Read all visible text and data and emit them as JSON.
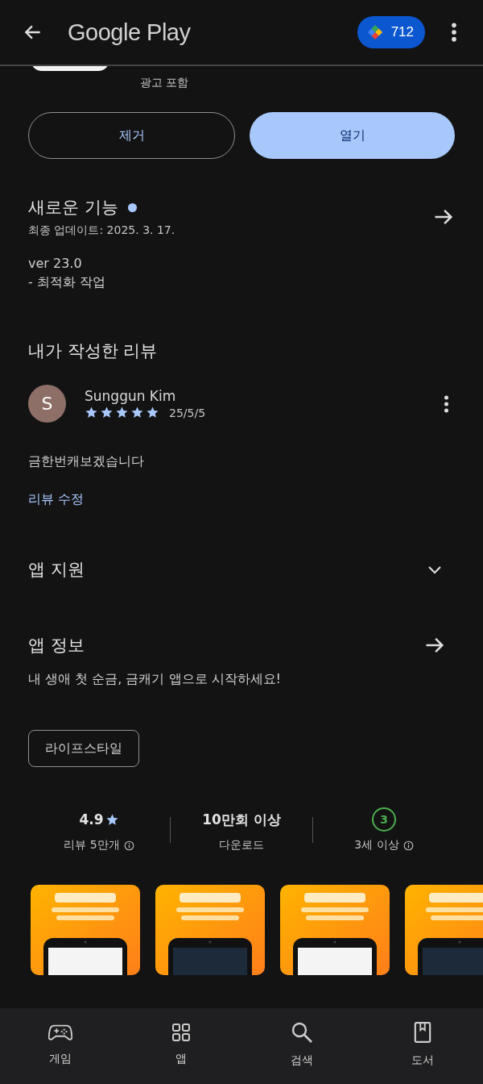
{
  "header": {
    "title": "Google Play",
    "points": "712"
  },
  "app": {
    "ads_note": "광고 포함"
  },
  "actions": [
    {
      "label": "제거",
      "kind": "outline"
    },
    {
      "label": "열기",
      "kind": "filled"
    }
  ],
  "whats_new": {
    "title": "새로운 기능",
    "updated": "최종 업데이트: 2025. 3. 17.",
    "notes": [
      "ver 23.0",
      "- 최적화 작업"
    ]
  },
  "my_review": {
    "title": "내가 작성한 리뷰",
    "author": "Sunggun Kim",
    "avatar_letter": "S",
    "stars": 5,
    "date": "25/5/5",
    "text": "금한번캐보겠습니다",
    "edit_link": "리뷰 수정"
  },
  "app_support": {
    "title": "앱 지원",
    "expanded": false
  },
  "about": {
    "title": "앱 정보",
    "description": "내 생애 첫 순금, 금캐기 앱으로 시작하세요!",
    "tags": [
      "라이프스타일"
    ]
  },
  "stats": [
    {
      "kind": "rating",
      "value": "4.9",
      "label": "리뷰 5만개"
    },
    {
      "kind": "plain",
      "value": "10만회 이상",
      "label": "다운로드"
    },
    {
      "kind": "age",
      "value": "3",
      "label": "3세 이상"
    }
  ],
  "bottom_nav": [
    {
      "label": "게임",
      "kind": "game",
      "selected": false
    },
    {
      "label": "앱",
      "kind": "apps",
      "selected": false
    },
    {
      "label": "검색",
      "kind": "search",
      "selected": false
    },
    {
      "label": "도서",
      "kind": "book",
      "selected": false
    }
  ]
}
